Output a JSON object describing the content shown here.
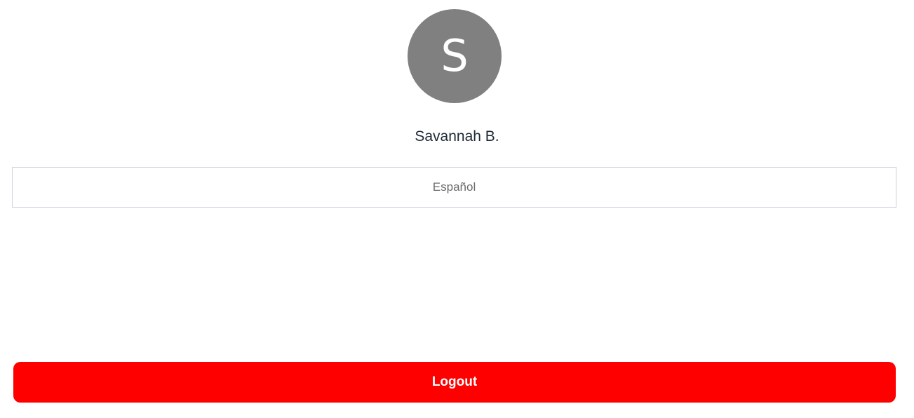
{
  "profile": {
    "avatar_initial": "S",
    "avatar_color": "#808080",
    "user_name": "Savannah B."
  },
  "language": {
    "selected": "Español"
  },
  "actions": {
    "logout_label": "Logout",
    "logout_color": "#ff0000"
  }
}
